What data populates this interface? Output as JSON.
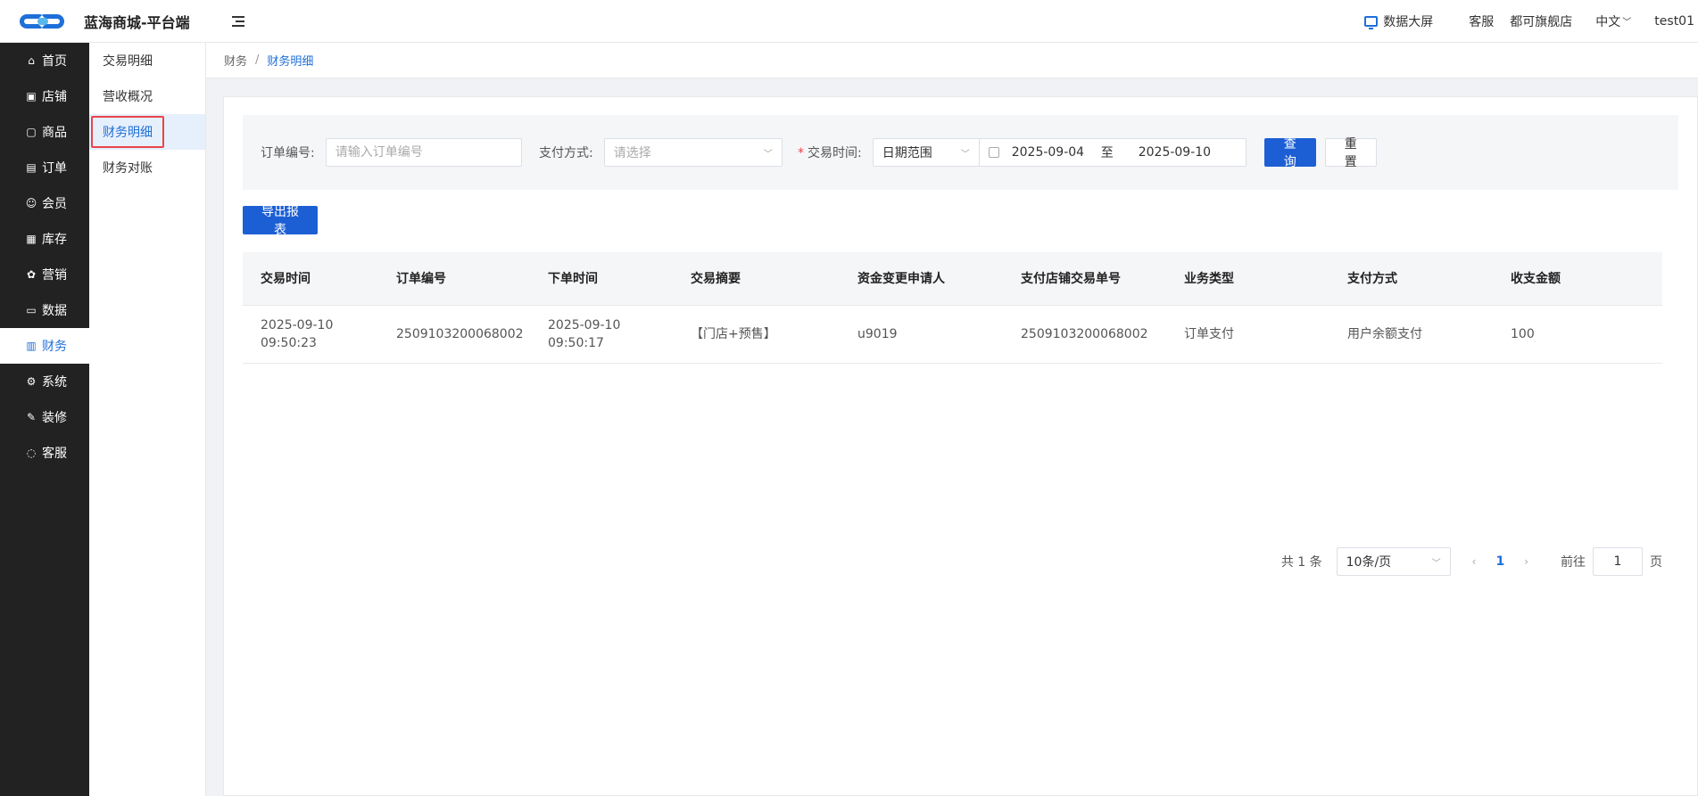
{
  "header": {
    "title": "蓝海商城-平台端",
    "data_screen": "数据大屏",
    "customer_service": "客服",
    "store": "都可旗舰店",
    "language": "中文",
    "user": "test01"
  },
  "sidebar": {
    "items": [
      {
        "label": "首页",
        "icon": "home-icon"
      },
      {
        "label": "店铺",
        "icon": "shop-icon"
      },
      {
        "label": "商品",
        "icon": "goods-icon"
      },
      {
        "label": "订单",
        "icon": "order-icon"
      },
      {
        "label": "会员",
        "icon": "member-icon"
      },
      {
        "label": "库存",
        "icon": "stock-icon"
      },
      {
        "label": "营销",
        "icon": "gift-icon"
      },
      {
        "label": "数据",
        "icon": "data-icon"
      },
      {
        "label": "财务",
        "icon": "finance-icon"
      },
      {
        "label": "系统",
        "icon": "gear-icon"
      },
      {
        "label": "装修",
        "icon": "decor-icon"
      },
      {
        "label": "客服",
        "icon": "chat-icon"
      }
    ]
  },
  "subnav": {
    "items": [
      "交易明细",
      "营收概况",
      "财务明细",
      "财务对账"
    ]
  },
  "breadcrumb": {
    "parent": "财务",
    "separator": "/",
    "current": "财务明细"
  },
  "filter": {
    "order_no_label": "订单编号:",
    "order_no_placeholder": "请输入订单编号",
    "pay_method_label": "支付方式:",
    "pay_method_placeholder": "请选择",
    "trade_time_required": "*",
    "trade_time_label": "交易时间:",
    "date_type": "日期范围",
    "start_date": "2025-09-04",
    "range_sep": "至",
    "end_date": "2025-09-10",
    "search_button": "查询",
    "reset_button": "重置"
  },
  "export_button": "导出报表",
  "table": {
    "columns": [
      "交易时间",
      "订单编号",
      "下单时间",
      "交易摘要",
      "资金变更申请人",
      "支付店铺交易单号",
      "业务类型",
      "支付方式",
      "收支金额"
    ],
    "rows": [
      {
        "trade_date": "2025-09-10",
        "trade_clock": "09:50:23",
        "order_no": "2509103200068002",
        "order_time": "2025-09-10 09:50:17",
        "summary": "【门店+预售】",
        "applicant": "u9019",
        "shop_trade_no": "2509103200068002",
        "biz_type": "订单支付",
        "pay_method": "用户余额支付",
        "amount": "100"
      }
    ]
  },
  "pagination": {
    "total": "共 1 条",
    "page_size": "10条/页",
    "current_page": "1",
    "goto_label": "前往",
    "goto_value": "1",
    "page_suffix": "页"
  },
  "colors": {
    "primary": "#1c5fd4",
    "sidebar_bg": "#222222",
    "highlight_border": "#e8454a"
  }
}
